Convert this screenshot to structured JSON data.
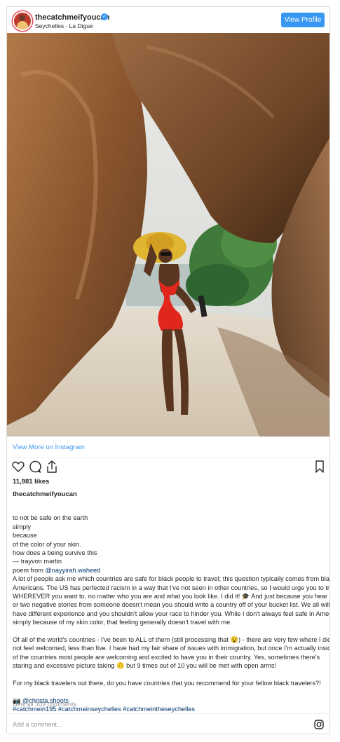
{
  "header": {
    "username": "thecatchmeifyoucan",
    "verified_icon": "verified-badge-icon",
    "location": "Seychelles - La Digue",
    "view_profile_label": "View Profile"
  },
  "post": {
    "image_alt": "Woman in red swimsuit and straw hat between granite boulders on a beach"
  },
  "links": {
    "view_more": "View More on Instagram"
  },
  "actions": {
    "like_icon": "heart-icon",
    "comment_icon": "comment-icon",
    "share_icon": "share-icon",
    "save_icon": "bookmark-icon"
  },
  "likes": "11,981 likes",
  "caption": {
    "username": "thecatchmeifyoucan",
    "poem": [
      "to not be safe on the earth",
      "simply",
      "because",
      "of the color of your skin.",
      "how does a being survive this",
      "— trayvon martin"
    ],
    "poem_from_prefix": "poem from ",
    "poem_from_mention": "@nayyirah.waheed",
    "para1": [
      "A lot of people ask me which countries are safe for black people to travel; this question typically comes from black",
      "Americans. The US has perfected racism in a way that I've not seen in other countries, so I would urge you to travel",
      "WHEREVER you want to, no matter who you are and what you look like. I did it! 🎓 And just because you hear one",
      "or two negative stories from someone doesn't mean you should write a country off of your bucket list. We all will",
      "have different experience and you shouldn't allow your race to hinder you. While I don't always feel safe in America",
      "simply because of my skin color, that feeling generally doesn't travel with me."
    ],
    "para2": [
      "Of all of the world's countries - I've been to ALL of them (still processing that 😵) - there are very few where I did",
      "not feel welcomed, less than five. I have had my fair share of issues with immigration, but once I'm actually inside",
      "of the countries most people are welcoming and excited to have you in their country. Yes, sometimes there's",
      "staring and excessive picture taking 🙃 but 9 times out of 10 you will be met with open arms!"
    ],
    "para3": "For my black travelers out there, do you have countries that you recommend for your fellow black travelers?!",
    "photo_credit_prefix": "📷 ",
    "photo_credit": "@christa.shoots",
    "hashtags": "#catchmein195 #catchmeinseychelles #catchmeintheseychelles"
  },
  "comments": {
    "view_all": "view all 309 comments",
    "placeholder": "Add a comment..."
  },
  "footer": {
    "logo_icon": "instagram-logo-icon"
  }
}
